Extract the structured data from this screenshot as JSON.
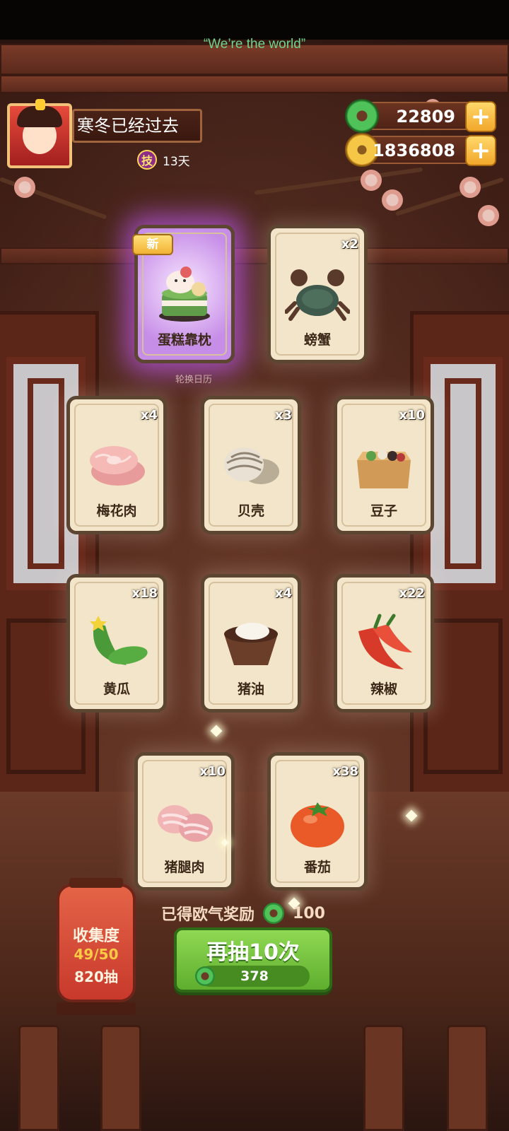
{
  "status": {
    "now_playing": "“We’re the world”"
  },
  "player": {
    "name": "寒冬已经过去",
    "skill_badge": "技",
    "skill_days": "13天"
  },
  "currencies": [
    {
      "icon": "jade-icon",
      "value": "22809"
    },
    {
      "icon": "coin-icon",
      "value": "1836808"
    }
  ],
  "new_tag": "新",
  "calendar_label": "轮换日历",
  "cards": [
    {
      "label": "蛋糕靠枕",
      "count": "",
      "art": "cake-pillow-icon",
      "is_new": true
    },
    {
      "label": "螃蟹",
      "count": "x2",
      "art": "crab-icon",
      "is_new": false
    },
    {
      "label": "梅花肉",
      "count": "x4",
      "art": "pork-shoulder-icon",
      "is_new": false
    },
    {
      "label": "贝壳",
      "count": "x3",
      "art": "shell-icon",
      "is_new": false
    },
    {
      "label": "豆子",
      "count": "x10",
      "art": "beans-box-icon",
      "is_new": false
    },
    {
      "label": "黄瓜",
      "count": "x18",
      "art": "cucumber-icon",
      "is_new": false
    },
    {
      "label": "猪油",
      "count": "x4",
      "art": "lard-bowl-icon",
      "is_new": false
    },
    {
      "label": "辣椒",
      "count": "x22",
      "art": "chili-icon",
      "is_new": false
    },
    {
      "label": "猪腿肉",
      "count": "x10",
      "art": "pork-leg-icon",
      "is_new": false
    },
    {
      "label": "番茄",
      "count": "x38",
      "art": "tomato-icon",
      "is_new": false
    }
  ],
  "collection": {
    "title": "收集度",
    "progress": "49/50",
    "draws": "820抽"
  },
  "reward": {
    "label": "已得欧气奖励",
    "amount": "100"
  },
  "redraw": {
    "label": "再抽10次",
    "cost": "378"
  },
  "colors": {
    "jade": "#4fc25a",
    "gold": "#f6c646",
    "button_green": "#6fbf38",
    "new_glow": "#c45cff"
  }
}
